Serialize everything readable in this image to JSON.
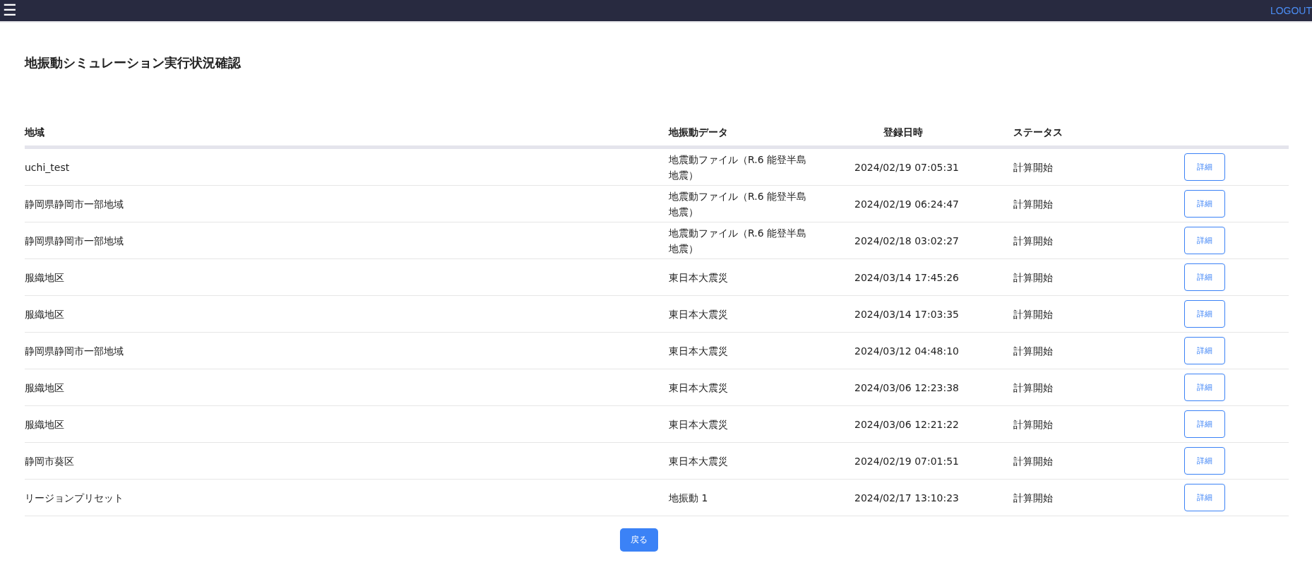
{
  "header": {
    "menu_icon": "☰",
    "logout": "LOGOUT"
  },
  "title": "地振動シミュレーション実行状況確認",
  "table": {
    "columns": [
      "地域",
      "地振動データ",
      "登録日時",
      "ステータス"
    ],
    "rows": [
      {
        "region": "uchi_test",
        "data": "地震動ファイル（R.6 能登半島地震）",
        "registered": "2024/02/19 07:05:31",
        "status": "計算開始",
        "action": "詳細"
      },
      {
        "region": "静岡県静岡市一部地域",
        "data": "地震動ファイル（R.6 能登半島地震）",
        "registered": "2024/02/19 06:24:47",
        "status": "計算開始",
        "action": "詳細"
      },
      {
        "region": "静岡県静岡市一部地域",
        "data": "地震動ファイル（R.6 能登半島地震）",
        "registered": "2024/02/18 03:02:27",
        "status": "計算開始",
        "action": "詳細"
      },
      {
        "region": "服織地区",
        "data": "東日本大震災",
        "registered": "2024/03/14 17:45:26",
        "status": "計算開始",
        "action": "詳細"
      },
      {
        "region": "服織地区",
        "data": "東日本大震災",
        "registered": "2024/03/14 17:03:35",
        "status": "計算開始",
        "action": "詳細"
      },
      {
        "region": "静岡県静岡市一部地域",
        "data": "東日本大震災",
        "registered": "2024/03/12 04:48:10",
        "status": "計算開始",
        "action": "詳細"
      },
      {
        "region": "服織地区",
        "data": "東日本大震災",
        "registered": "2024/03/06 12:23:38",
        "status": "計算開始",
        "action": "詳細"
      },
      {
        "region": "服織地区",
        "data": "東日本大震災",
        "registered": "2024/03/06 12:21:22",
        "status": "計算開始",
        "action": "詳細"
      },
      {
        "region": "静岡市葵区",
        "data": "東日本大震災",
        "registered": "2024/02/19 07:01:51",
        "status": "計算開始",
        "action": "詳細"
      },
      {
        "region": "リージョンプリセット",
        "data": "地振動 1",
        "registered": "2024/02/17 13:10:23",
        "status": "計算開始",
        "action": "詳細"
      }
    ]
  },
  "back_button": "戻る"
}
